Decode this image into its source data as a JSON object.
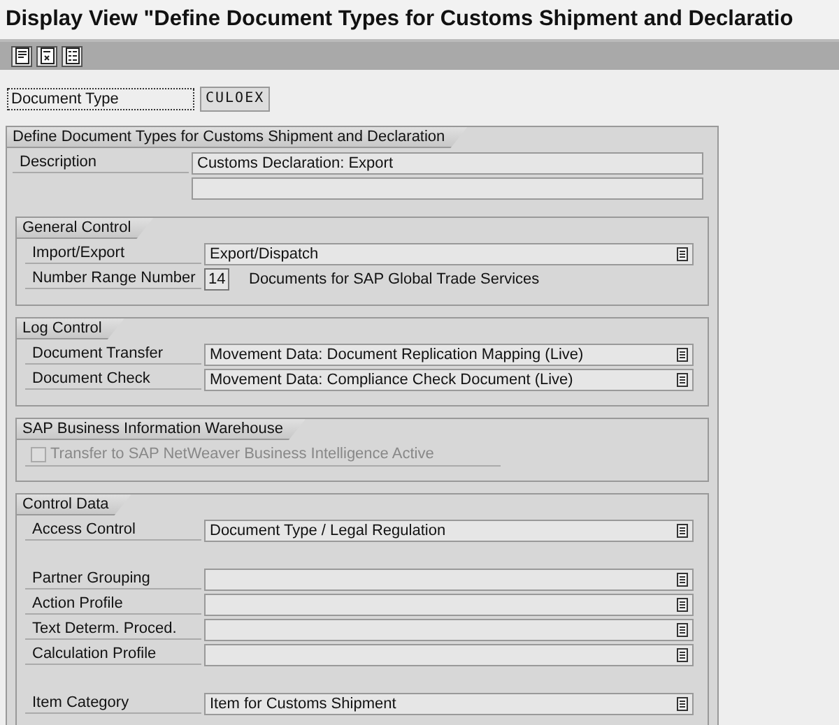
{
  "window": {
    "title": "Display View \"Define Document Types for Customs Shipment and Declaratio"
  },
  "toolbar": {
    "buttons": [
      {
        "kind": "detail"
      },
      {
        "kind": "other"
      },
      {
        "kind": "list"
      }
    ]
  },
  "key_field": {
    "label": "Document Type",
    "value": "CULOEX"
  },
  "main_group": {
    "title": "Define Document Types for Customs Shipment and Declaration",
    "rows": [
      {
        "label": "Description",
        "value": "Customs Declaration: Export"
      },
      {}
    ],
    "groups": [
      {
        "title": "General Control",
        "rows": [
          {
            "kind": "dropdown",
            "label": "Import/Export",
            "value": "Export/Dispatch"
          },
          {
            "kind": "number",
            "label": "Number Range Number",
            "value": "14",
            "description": "Documents for SAP Global Trade Services"
          }
        ]
      },
      {
        "title": "Log Control",
        "rows": [
          {
            "kind": "dropdown",
            "label": "Document Transfer",
            "value": "Movement Data: Document Replication Mapping (Live)"
          },
          {
            "kind": "dropdown",
            "label": "Document Check",
            "value": "Movement Data: Compliance Check Document (Live)"
          }
        ]
      },
      {
        "title": "SAP Business Information Warehouse",
        "rows": [
          {
            "kind": "checkbox",
            "label": "Transfer to SAP NetWeaver Business Intelligence Active",
            "checked": false,
            "disabled": true
          }
        ]
      },
      {
        "title": "Control Data",
        "rows": [
          {
            "kind": "dropdown",
            "label": "Access Control",
            "value": "Document Type / Legal Regulation"
          },
          {
            "kind": "spacer"
          },
          {
            "kind": "dropdown",
            "label": "Partner Grouping"
          },
          {
            "kind": "dropdown",
            "label": "Action Profile"
          },
          {
            "kind": "dropdown",
            "label": "Text Determ. Proced."
          },
          {
            "kind": "dropdown",
            "label": "Calculation Profile"
          },
          {
            "kind": "spacer"
          },
          {
            "kind": "dropdown",
            "label": "Item Category",
            "value": "Item for Customs Shipment"
          }
        ]
      }
    ]
  }
}
